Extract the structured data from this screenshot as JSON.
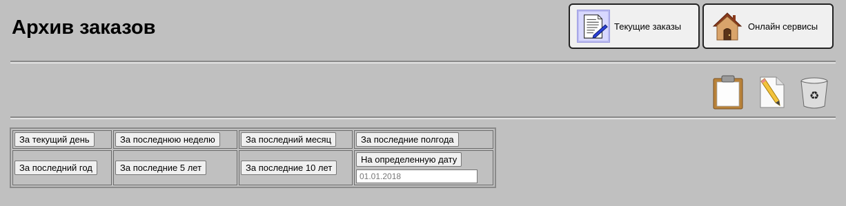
{
  "header": {
    "title": "Архив заказов"
  },
  "nav": {
    "current_orders": {
      "label": "Текущие заказы",
      "icon": "document-pen-icon"
    },
    "online_services": {
      "label": "Онлайн сервисы",
      "icon": "house-icon"
    }
  },
  "toolbar": {
    "icons": [
      "clipboard-icon",
      "edit-pencil-icon",
      "recycle-bin-icon"
    ]
  },
  "periods": {
    "today": "За текущий день",
    "week": "За последнюю неделю",
    "month": "За последний месяц",
    "half_year": "За последние полгода",
    "year": "За последний год",
    "five_years": "За последние 5 лет",
    "ten_years": "За последние 10 лет",
    "specific_date": "На определенную дату",
    "date_value": "01.01.2018"
  },
  "colors": {
    "background": "#c0c0c0",
    "button_face": "#f0f0f0"
  }
}
